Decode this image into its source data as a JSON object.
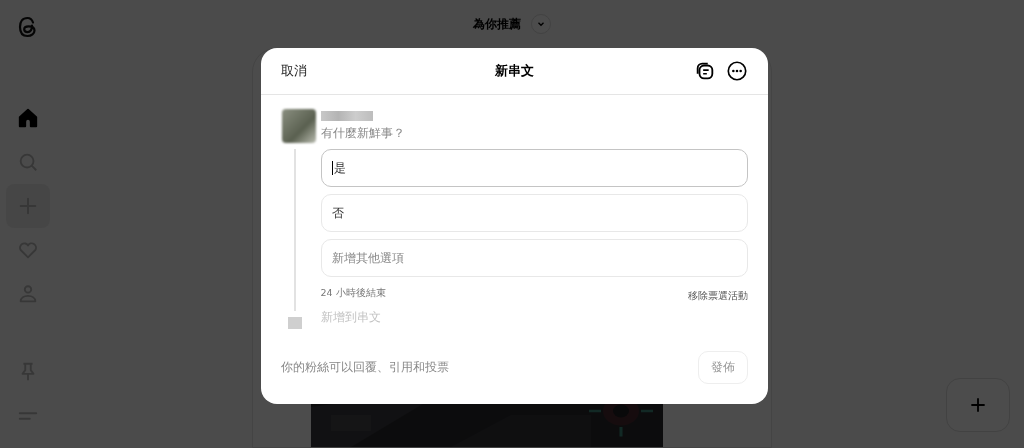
{
  "sidebar": {
    "items": [
      {
        "kind": "home",
        "selected": true
      },
      {
        "kind": "search",
        "selected": false
      },
      {
        "kind": "create",
        "selected": false
      },
      {
        "kind": "activity",
        "selected": false
      },
      {
        "kind": "profile",
        "selected": false
      }
    ],
    "bottom": [
      {
        "kind": "pin"
      },
      {
        "kind": "menu"
      }
    ]
  },
  "feed": {
    "title": "為你推薦"
  },
  "dialog": {
    "cancel": "取消",
    "title": "新串文",
    "prompt": {
      "placeholder": "有什麼新鮮事？"
    },
    "poll": {
      "options": [
        {
          "value": "是",
          "focused": true
        },
        {
          "value": "否",
          "focused": false
        },
        {
          "placeholder": "新增其他選項",
          "focused": false
        }
      ],
      "duration": "24 小時後結束",
      "remove": "移除票選活動"
    },
    "add_thread": {
      "placeholder": "新增到串文"
    },
    "footer": "你的粉絲可以回覆、引用和投票",
    "post_button": {
      "label": "發佈",
      "disabled": true
    }
  }
}
